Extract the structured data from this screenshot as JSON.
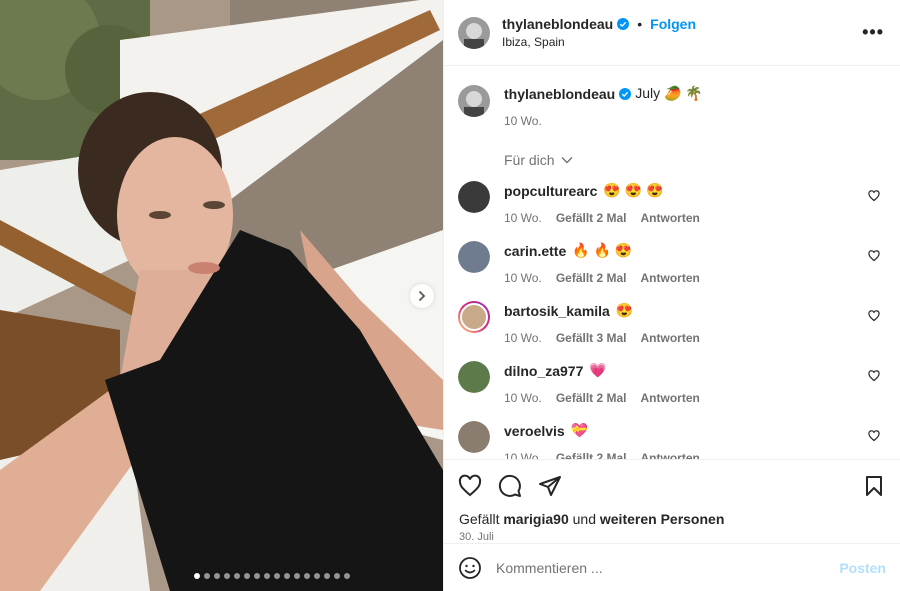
{
  "post": {
    "author": "thylaneblondeau",
    "follow_label": "Folgen",
    "separator": "•",
    "location": "Ibiza, Spain",
    "more_label": "•••"
  },
  "caption": {
    "author": "thylaneblondeau",
    "text": "July 🥭 🌴",
    "age": "10 Wo."
  },
  "for_you_label": "Für dich",
  "comments": [
    {
      "user": "popculturearc",
      "text": "😍 😍 😍",
      "age": "10 Wo.",
      "likes": "Gefällt 2 Mal",
      "reply": "Antworten",
      "avatar_color": "#3a3a3a"
    },
    {
      "user": "carin.ette",
      "text": "🔥 🔥 😍",
      "age": "10 Wo.",
      "likes": "Gefällt 2 Mal",
      "reply": "Antworten",
      "avatar_color": "#6f7c8f"
    },
    {
      "user": "bartosik_kamila",
      "text": "😍",
      "age": "10 Wo.",
      "likes": "Gefällt 3 Mal",
      "reply": "Antworten",
      "avatar_color": "#c8a98a"
    },
    {
      "user": "dilno_za977",
      "text": "💗",
      "age": "10 Wo.",
      "likes": "Gefällt 2 Mal",
      "reply": "Antworten",
      "avatar_color": "#5d7a4a"
    },
    {
      "user": "veroelvis",
      "text": "💝",
      "age": "10 Wo.",
      "likes": "Gefällt 2 Mal",
      "reply": "Antworten",
      "avatar_color": "#8a7d6f"
    }
  ],
  "likes": {
    "prefix": "Gefällt",
    "user": "marigia90",
    "connector": "und",
    "rest": "weiteren Personen"
  },
  "date": "30. Juli",
  "comment_input": {
    "placeholder": "Kommentieren ...",
    "post_label": "Posten"
  },
  "carousel": {
    "total": 16,
    "current": 1
  },
  "colors": {
    "accent": "#0095f6",
    "muted": "#737373",
    "verified": "#0095f6"
  }
}
